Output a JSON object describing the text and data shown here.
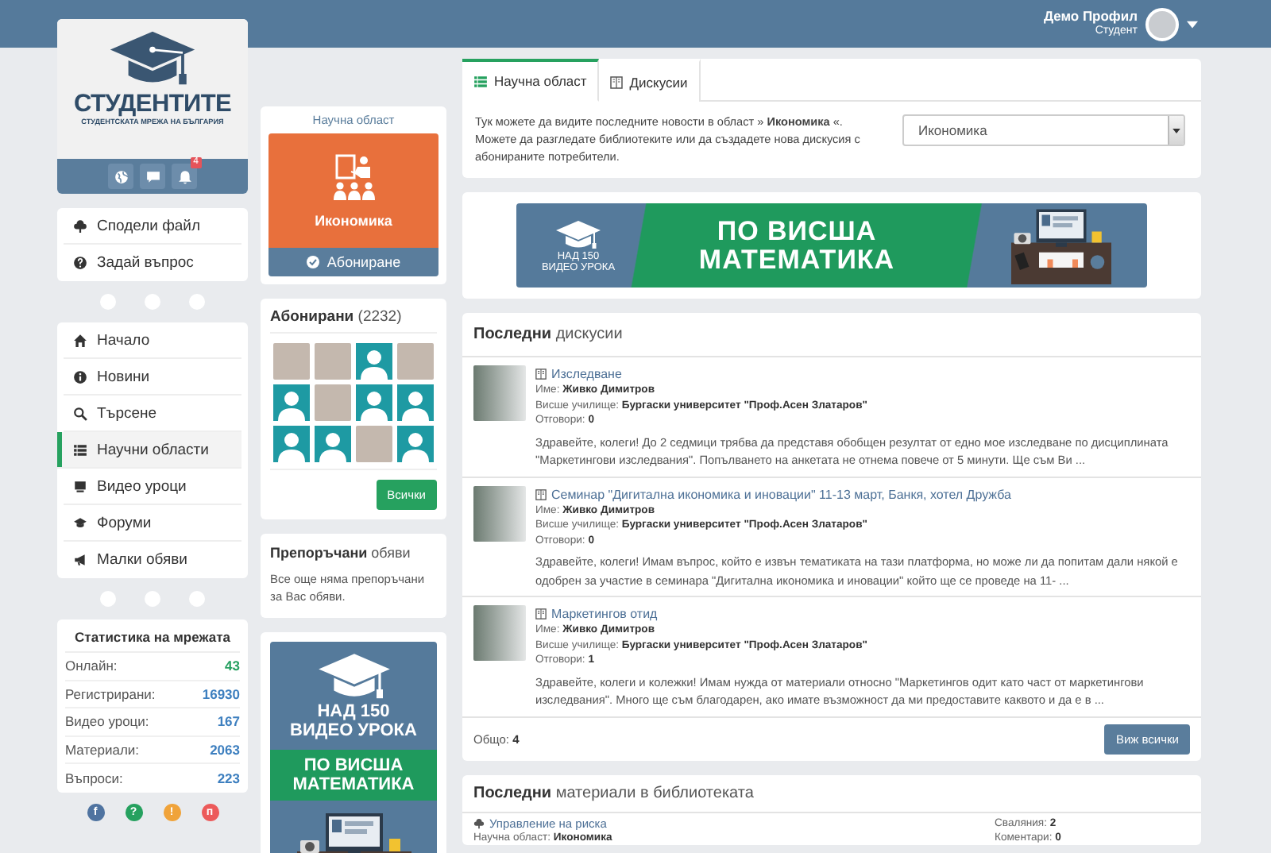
{
  "top_bar": {
    "user_name": "Демо Профил",
    "user_role": "Студент"
  },
  "logo": {
    "title": "СТУДЕНТИТЕ",
    "subtitle": "СТУДЕНТСКАТА МРЕЖА НА БЪЛГАРИЯ",
    "notification_count": "4"
  },
  "quick_actions": [
    {
      "label": "Сподели файл"
    },
    {
      "label": "Задай въпрос"
    }
  ],
  "navigation": [
    {
      "label": "Начало",
      "selected": false
    },
    {
      "label": "Новини",
      "selected": false
    },
    {
      "label": "Търсене",
      "selected": false
    },
    {
      "label": "Научни области",
      "selected": true
    },
    {
      "label": "Видео уроци",
      "selected": false
    },
    {
      "label": "Форуми",
      "selected": false
    },
    {
      "label": "Малки обяви",
      "selected": false
    }
  ],
  "network_stats": {
    "title": "Статистика на мрежата",
    "rows": [
      {
        "label": "Онлайн:",
        "value": "43",
        "color": "#27a061"
      },
      {
        "label": "Регистрирани:",
        "value": "16930",
        "color": "#3d7fbf"
      },
      {
        "label": "Видео уроци:",
        "value": "167",
        "color": "#3d7fbf"
      },
      {
        "label": "Материали:",
        "value": "2063",
        "color": "#3d7fbf"
      },
      {
        "label": "Въпроси:",
        "value": "223",
        "color": "#3d7fbf"
      }
    ]
  },
  "footer_links": [
    {
      "glyph": "f",
      "color": "#4f73a0"
    },
    {
      "glyph": "?",
      "color": "#26a15f"
    },
    {
      "glyph": "!",
      "color": "#f0a33a"
    },
    {
      "glyph": "п",
      "color": "#ec5a5a"
    }
  ],
  "area_card": {
    "caption": "Научна област",
    "name": "Икономика",
    "subscribe_button": "Абониране"
  },
  "subscribers": {
    "title": "**Абонирани** (2232)",
    "button": "Всички",
    "avatars": [
      {
        "kind": "photo"
      },
      {
        "kind": "photo"
      },
      {
        "kind": "placeholder"
      },
      {
        "kind": "photo"
      },
      {
        "kind": "placeholder"
      },
      {
        "kind": "photo"
      },
      {
        "kind": "placeholder"
      },
      {
        "kind": "placeholder"
      },
      {
        "kind": "placeholder"
      },
      {
        "kind": "placeholder"
      },
      {
        "kind": "photo"
      },
      {
        "kind": "placeholder"
      }
    ]
  },
  "recommended": {
    "title": "**Препоръчани** обяви",
    "text": "Все още няма препоръчани за Вас обяви."
  },
  "side_ad": {
    "lines_top": [
      "НАД 150",
      "ВИДЕО УРОКА"
    ],
    "lines_band": [
      "ПО ВИСША",
      "МАТЕМАТИКА"
    ]
  },
  "tabs": [
    {
      "label": "Научна област",
      "selected": true
    },
    {
      "label": "Дискусии",
      "selected": false
    }
  ],
  "area_intro": {
    "text": "Тук можете да видите последните новости в област » **Икономика** «. Можете да разгледате библиотеките или да създадете нова дискусия с абонираните потребители.",
    "select_value": "Икономика"
  },
  "banner": {
    "lines_left": [
      "НАД 150",
      "ВИДЕО УРОКА"
    ],
    "headline": [
      "ПО ВИСША",
      "МАТЕМАТИКА"
    ]
  },
  "discussions": {
    "title": "**Последни** дискусии",
    "items": [
      {
        "title": "Изследване",
        "fields": [
          {
            "label": "Име:",
            "value": "Живко Димитров"
          },
          {
            "label": "Висше училище:",
            "value": "Бургаски университет \"Проф.Асен Златаров\""
          },
          {
            "label": "Отговори:",
            "value": "0"
          }
        ],
        "excerpt": "Здравейте, колеги! До 2 седмици трябва да представя обобщен резултат от едно мое изследване по дисциплината \"Маркетингови изследвания\". Попълването на анкетата не отнема повече от 5 минути. Ще съм Ви ..."
      },
      {
        "title": "Семинар \"Дигитална икономика и иновации\" 11-13 март, Банкя, хотел Дружба",
        "fields": [
          {
            "label": "Име:",
            "value": "Живко Димитров"
          },
          {
            "label": "Висше училище:",
            "value": "Бургаски университет \"Проф.Асен Златаров\""
          },
          {
            "label": "Отговори:",
            "value": "0"
          }
        ],
        "excerpt": "Здравейте, колеги! Имам въпрос, който е извън тематиката на тази платформа, но може ли да попитам дали някой е одобрен за участие в семинара \"Дигитална икономика и иновации\" който ще се проведе на 11- ..."
      },
      {
        "title": "Маркетингов отид",
        "fields": [
          {
            "label": "Име:",
            "value": "Живко Димитров"
          },
          {
            "label": "Висше училище:",
            "value": "Бургаски университет \"Проф.Асен Златаров\""
          },
          {
            "label": "Отговори:",
            "value": "1"
          }
        ],
        "excerpt": "Здравейте, колеги и колежки! Имам нужда от материали относно \"Маркетингов одит като част от маркетингови изследвания\". Много ще съм благодарен, ако имате възможност да ми предоставите каквото и да е в ..."
      }
    ],
    "total_label": "Общо:",
    "total_value": "4",
    "view_all_button": "Виж всички"
  },
  "materials": {
    "title": "**Последни** материали в библиотеката",
    "items": [
      {
        "title": "Управление на риска",
        "area_label": "Научна област:",
        "area_value": "Икономика",
        "downloads_label": "Сваляния:",
        "downloads_value": "2",
        "comments_label": "Коментари:",
        "comments_value": "0"
      }
    ]
  }
}
